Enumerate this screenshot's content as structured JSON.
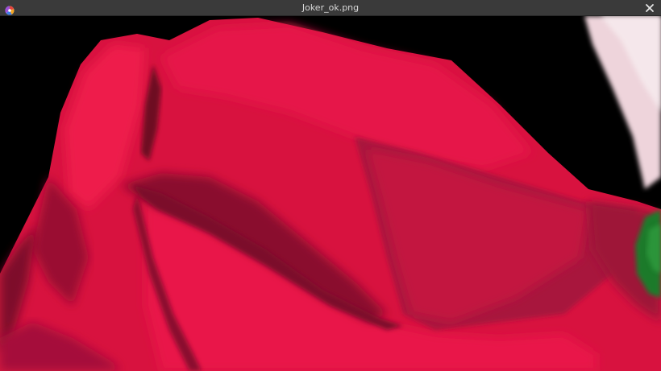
{
  "window": {
    "title": "Joker_ok.png"
  },
  "icons": {
    "app": "image-viewer-app-icon",
    "close": "close-icon"
  },
  "colors": {
    "titlebar": "#3a3a3a",
    "title_text": "#d8d8d8",
    "background": "#000000",
    "paint_red": "#e01446",
    "paint_dark_red": "#7a0f2a",
    "paint_pink": "#f3dde3",
    "paint_green": "#1f7a2e"
  }
}
